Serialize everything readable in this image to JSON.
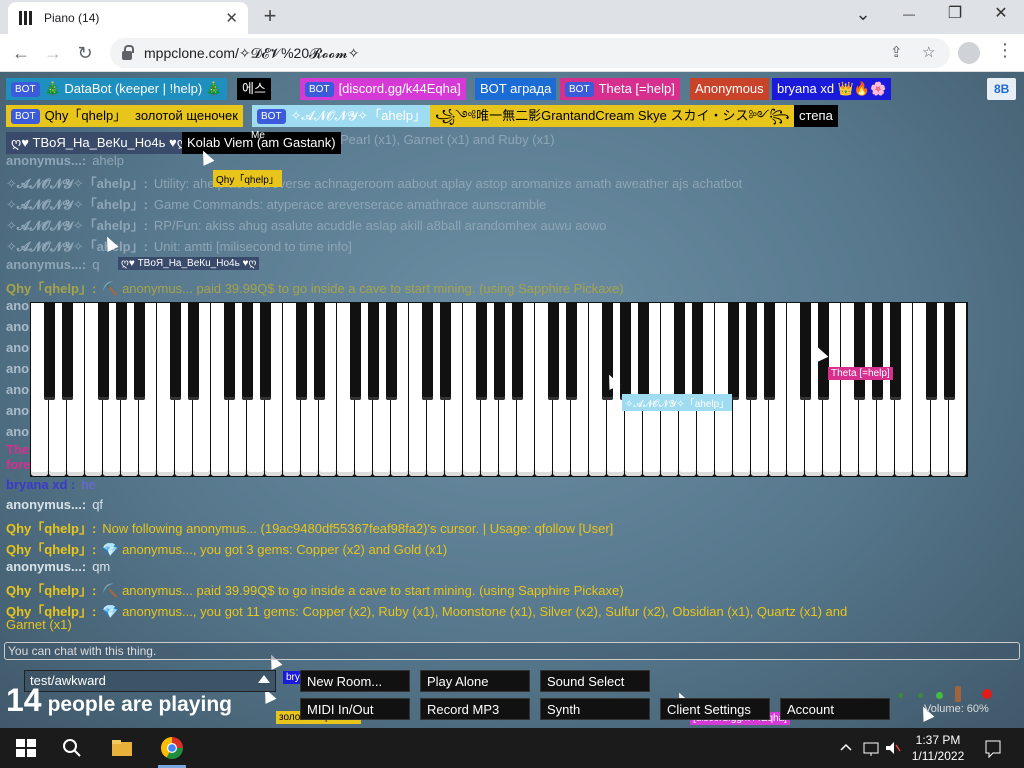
{
  "browser": {
    "tab_title": "Piano (14)",
    "close_glyph": "✕",
    "newtab_glyph": "+",
    "url": "mppclone.com/✧𝓓𝓔𝓥%20𝓡𝓸𝓸𝓶✧",
    "back": "←",
    "forward": "→",
    "reload": "↻",
    "min": "—",
    "restore": "❐",
    "close": "✕",
    "tablist": "⌄",
    "share": "⇪",
    "star": "☆",
    "menu": "⋮"
  },
  "users": [
    {
      "bot": "BOT",
      "name": "🎄 DataBot (keeper | !help) 🎄",
      "bg": "#1e8fbf"
    },
    {
      "bot": "",
      "name": "에스",
      "bg": "#000000"
    },
    {
      "bot": "BOT",
      "name": "[discord.gg/k44Eqha]",
      "bg": "#d63ad6"
    },
    {
      "bot": "",
      "name": "BOT аграда",
      "bg": "#1c6cd6"
    },
    {
      "bot": "BOT",
      "name": "Theta [=help]",
      "bg": "#d62f8e"
    },
    {
      "bot": "",
      "name": "Anonymous",
      "bg": "#c9432a"
    },
    {
      "bot": "",
      "name": "bryana xd 👑🔥🌸",
      "bg": "#1a1adb"
    },
    {
      "bot": "BOT",
      "name": "Qhy「qhelp」",
      "bg": "#e8c51a"
    },
    {
      "bot": "",
      "name": "золотой щеночек",
      "bg": "#e8c51a"
    },
    {
      "bot": "BOT",
      "name": "✧𝓐𝓝𝓞𝓝𝓨✧「ahelp」",
      "bg": "#9fdcf2"
    },
    {
      "bot": "",
      "name": "꧁༺唯一無二影GrantandCream Skye スカイ・シス༻꧂",
      "bg": "#e8c51a"
    },
    {
      "bot": "",
      "name": "степа",
      "bg": "#000000"
    },
    {
      "bot": "",
      "name": "ღ♥ ТВоЯ_На_ВеКu_Но4ь ♥ღ",
      "bg": "#3a4a6a"
    },
    {
      "bot": "",
      "name": "Kolab Viem (am Gastank)",
      "bg": "#000000"
    }
  ],
  "me_label": "Me",
  "bb_button": "8B",
  "chat": [
    {
      "name": "",
      "msg": "Pearl (x1), Garnet (x1) and Ruby (x1)",
      "color": "#8ea6b7"
    },
    {
      "name": "anonymus...:",
      "msg": "ahelp",
      "color": "#8ea6b7"
    },
    {
      "name": "✧𝓐𝓝𝓞𝓝𝓨✧「ahelp」:",
      "msg": "Utility: ahelp aedit areverse achnageroom aabout aplay astop aromanize amath aweather ajs achatbot",
      "color": "#8ea6b7"
    },
    {
      "name": "✧𝓐𝓝𝓞𝓝𝓨✧「ahelp」:",
      "msg": "Game Commands: atyperace areverserace amathrace aunscramble",
      "color": "#8ea6b7"
    },
    {
      "name": "✧𝓐𝓝𝓞𝓝𝓨✧「ahelp」:",
      "msg": "RP/Fun: akiss ahug asalute acuddle aslap akill a8ball arandomhex auwu aowo",
      "color": "#8ea6b7"
    },
    {
      "name": "✧𝓐𝓝𝓞𝓝𝓨✧「ahelp」:",
      "msg": "Unit: amtti [milisecond to time info]",
      "color": "#8ea6b7"
    },
    {
      "name": "anonymus...:",
      "msg": "q",
      "color": "#8ea6b7"
    },
    {
      "name": "Qhy「qhelp」:",
      "msg": "⛏️ anonymus... paid 39.99Q$ to go inside a cave to start mining. (using Sapphire Pickaxe)",
      "color": "#a7a34a"
    },
    {
      "name": "bryana xd :",
      "msg": "he",
      "color": "#3a3ac8"
    },
    {
      "name": "anonymus...:",
      "msg": "qf",
      "color": "#d9e2e8"
    },
    {
      "name": "Qhy「qhelp」:",
      "msg": "Now following anonymus... (19ac9480df55367feaf98fa2)'s cursor. | Usage: qfollow [User]",
      "color": "#e8c51a"
    },
    {
      "name": "Qhy「qhelp」:",
      "msg": "💎 anonymus..., you got 3 gems: Copper (x2) and Gold (x1)",
      "color": "#e8c51a"
    },
    {
      "name": "anonymus...:",
      "msg": "qm",
      "color": "#d9e2e8"
    },
    {
      "name": "Qhy「qhelp」:",
      "msg": "⛏️ anonymus... paid 39.99Q$ to go inside a cave to start mining. (using Sapphire Pickaxe)",
      "color": "#e8c51a"
    },
    {
      "name": "Qhy「qhelp」:",
      "msg": "💎 anonymus..., you got 11 gems: Copper (x2), Ruby (x1), Moonstone (x1), Silver (x2), Sulfur (x2), Obsidian (x1), Quartz (x1) and",
      "color": "#e8c51a"
    },
    {
      "name": "",
      "msg": "Garnet (x1)",
      "color": "#e8c51a"
    }
  ],
  "side_names": [
    "ano",
    "ano",
    "ano",
    "ano",
    "ano",
    "ano",
    "ano",
    "The",
    "fore"
  ],
  "cursor_tags": [
    {
      "label": "Qhy「qhelp」",
      "bg": "#e8c51a",
      "color": "#000"
    },
    {
      "label": "ღ♥ ТВоЯ_На_ВеКu_Но4ь ♥ღ",
      "bg": "#3a4a6a",
      "color": "#fff"
    },
    {
      "label": "✧𝓐𝓝𝓞𝓝𝓨✧「ahelp」",
      "bg": "#9fdcf2",
      "color": "#fff"
    },
    {
      "label": "Theta [=help]",
      "bg": "#d62f8e",
      "color": "#fff"
    },
    {
      "label": "bryana xd 👑🔥🌸",
      "bg": "#1a1adb",
      "color": "#fff"
    },
    {
      "label": "золотой щеночек",
      "bg": "#e8c51a",
      "color": "#000"
    },
    {
      "label": "[discord.gg/k44Eqha]",
      "bg": "#d63ad6",
      "color": "#fff"
    }
  ],
  "chat_input_placeholder": "You can chat with this thing.",
  "room": "test/awkward",
  "playing_count": "14",
  "playing_label": "people are playing",
  "buttons": {
    "new_room": "New Room...",
    "play_alone": "Play Alone",
    "sound_select": "Sound Select",
    "midi": "MIDI In/Out",
    "record": "Record MP3",
    "synth": "Synth",
    "client_settings": "Client Settings",
    "account": "Account"
  },
  "volume": "Volume: 60%",
  "taskbar": {
    "time": "1:37 PM",
    "date": "1/11/2022"
  }
}
